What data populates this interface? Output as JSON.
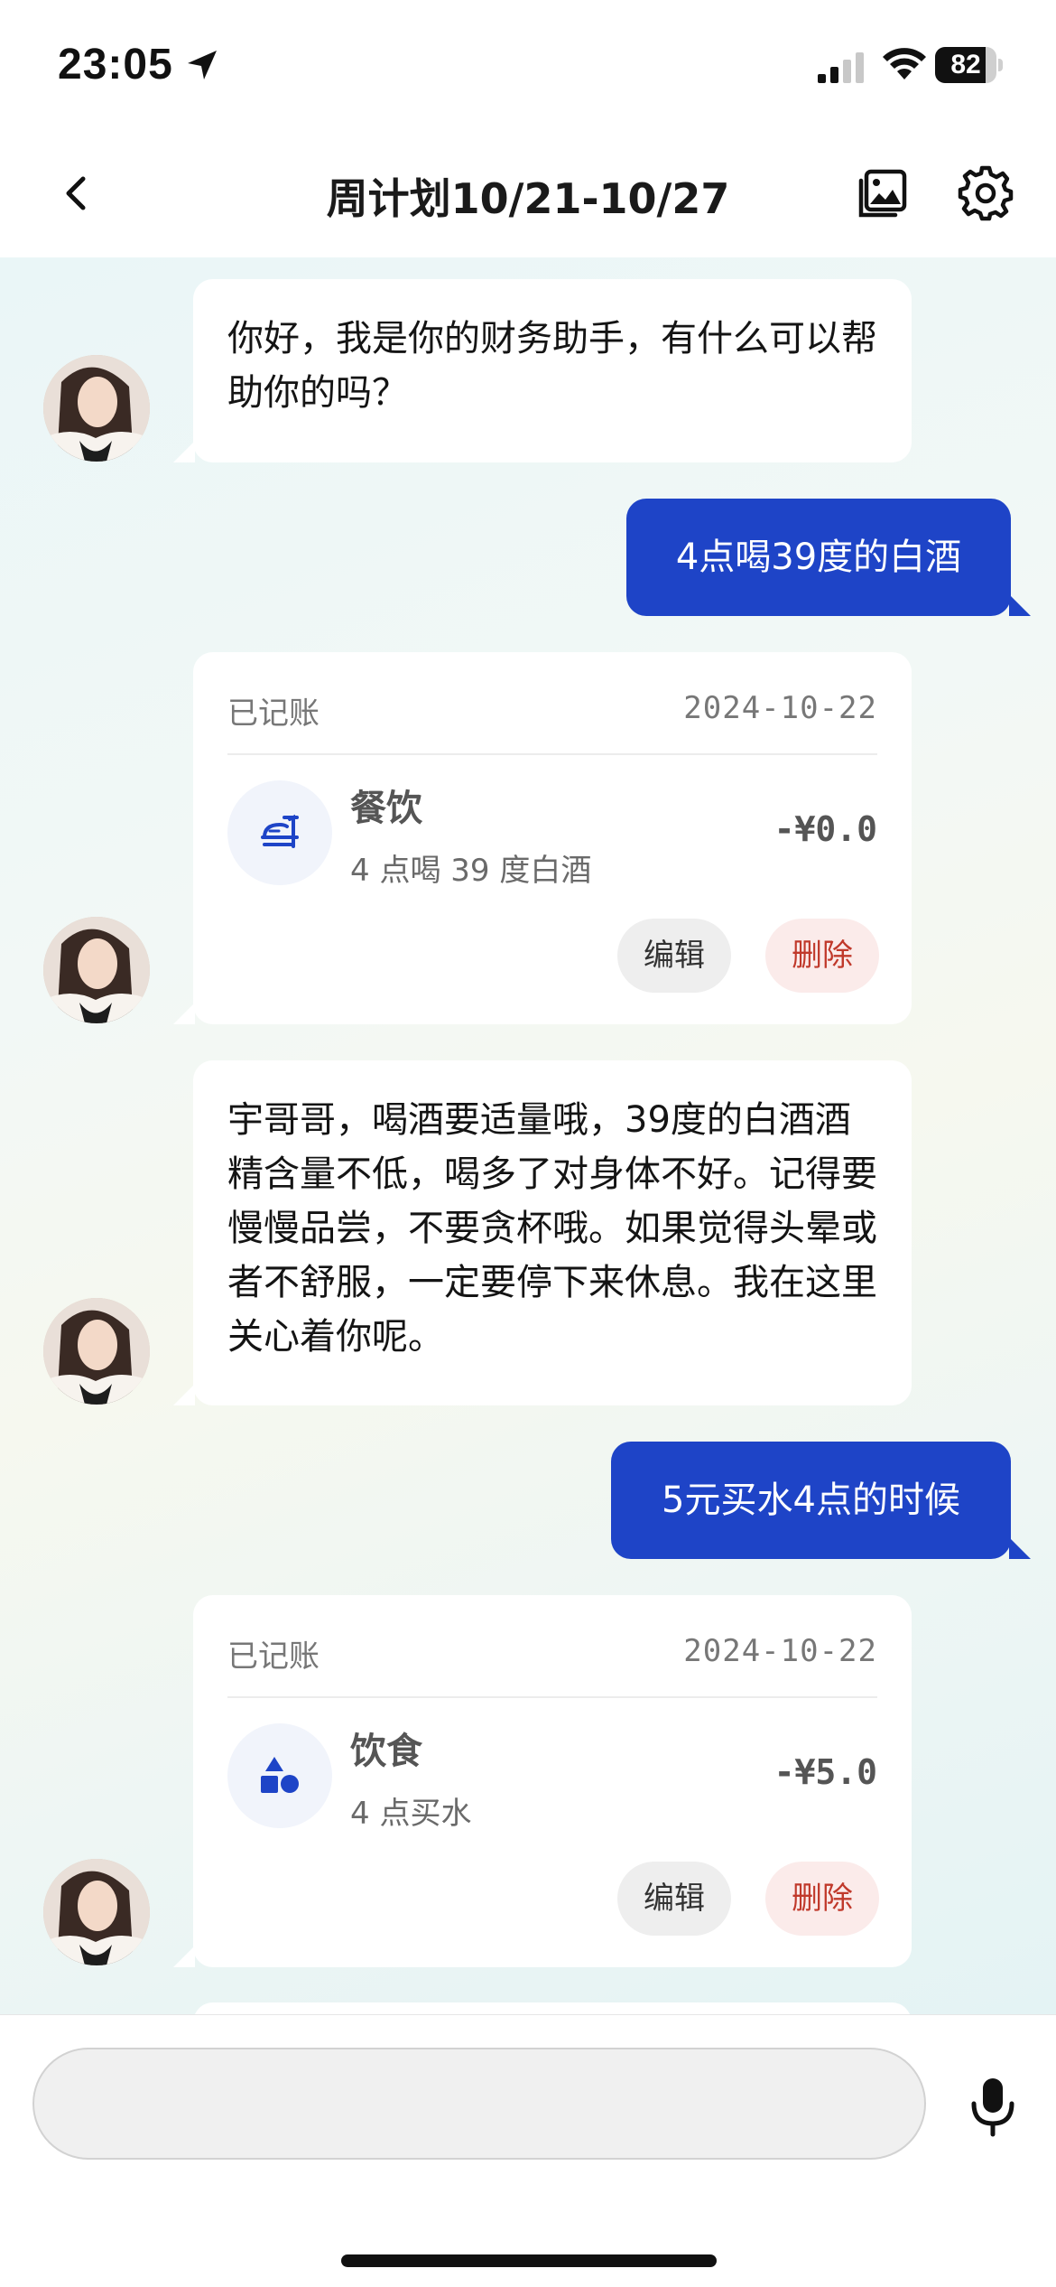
{
  "status_bar": {
    "time": "23:05",
    "battery": "82",
    "battery_level": 0.82
  },
  "header": {
    "title": "周计划10/21-10/27"
  },
  "messages": {
    "m1": {
      "text": "你好，我是你的财务助手，有什么可以帮助你的吗？"
    },
    "m2": {
      "text": "4点喝39度的白酒"
    },
    "m3": {
      "status": "已记账",
      "date": "2024-10-22",
      "category": "餐饮",
      "note": "4 点喝 39 度白酒",
      "amount": "-¥0.0",
      "edit_label": "编辑",
      "delete_label": "删除"
    },
    "m4": {
      "text": "宇哥哥，喝酒要适量哦，39度的白酒酒精含量不低，喝多了对身体不好。记得要慢慢品尝，不要贪杯哦。如果觉得头晕或者不舒服，一定要停下来休息。我在这里关心着你呢。"
    },
    "m5": {
      "text": "5元买水4点的时候"
    },
    "m6": {
      "status": "已记账",
      "date": "2024-10-22",
      "category": "饮食",
      "note": "4 点买水",
      "amount": "-¥5.0",
      "edit_label": "编辑",
      "delete_label": "删除"
    }
  },
  "input": {
    "value": "",
    "placeholder": ""
  },
  "icons": {
    "back": "chevron-left-icon",
    "gallery": "gallery-icon",
    "settings": "gear-icon",
    "record1": "food-icon",
    "record2": "shapes-icon",
    "mic": "microphone-icon"
  },
  "colors": {
    "accent": "#1e44c7",
    "delete": "#c0392b",
    "delete_bg": "#fbebea"
  }
}
